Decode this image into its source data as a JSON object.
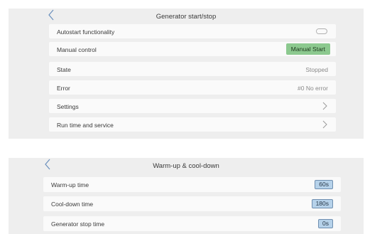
{
  "generator_panel": {
    "title": "Generator start/stop",
    "rows": [
      {
        "label": "Autostart functionality",
        "toggle_on": false
      },
      {
        "label": "Manual control",
        "button": "Manual Start"
      },
      {
        "label": "State",
        "value": "Stopped"
      },
      {
        "label": "Error",
        "value": "#0 No error"
      },
      {
        "label": "Settings"
      },
      {
        "label": "Run time and service"
      }
    ]
  },
  "warmup_panel": {
    "title": "Warm-up & cool-down",
    "rows": [
      {
        "label": "Warm-up time",
        "value": "60s"
      },
      {
        "label": "Cool-down time",
        "value": "180s"
      },
      {
        "label": "Generator stop time",
        "value": "0s"
      }
    ]
  },
  "icons": {
    "back": "chevron-left-icon",
    "forward": "chevron-right-icon",
    "toggle": "toggle-switch-icon"
  },
  "colors": {
    "panel_bg": "#eeeeee",
    "row_bg": "#fafafa",
    "start_button": "#8cc98f",
    "value_box": "#b6d2ea"
  }
}
